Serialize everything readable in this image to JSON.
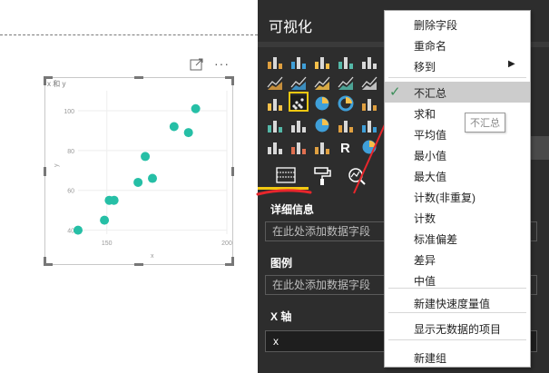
{
  "visual": {
    "title": "x 和 y",
    "focus_icon": "focus-mode-icon",
    "more_icon": "more-options-icon",
    "more_glyph": "···"
  },
  "chart_data": {
    "type": "scatter",
    "title": "x 和 y",
    "xlabel": "x",
    "ylabel": "y",
    "x_ticks": [
      "150",
      "200"
    ],
    "y_ticks": [
      "40",
      "60",
      "80",
      "100"
    ],
    "xlim": [
      138,
      200
    ],
    "ylim": [
      38,
      110
    ],
    "grid": true,
    "color": "#26bfa6",
    "points": [
      {
        "x": 138,
        "y": 40
      },
      {
        "x": 149,
        "y": 45
      },
      {
        "x": 151,
        "y": 55
      },
      {
        "x": 153,
        "y": 55
      },
      {
        "x": 163,
        "y": 64
      },
      {
        "x": 169,
        "y": 66
      },
      {
        "x": 166,
        "y": 77
      },
      {
        "x": 178,
        "y": 92
      },
      {
        "x": 184,
        "y": 89
      },
      {
        "x": 187,
        "y": 101
      }
    ]
  },
  "pane": {
    "title": "可视化",
    "tabs": [
      "fields-tab-icon",
      "format-paintroller-icon",
      "analytics-magnifier-icon"
    ],
    "wells": {
      "details_label": "详细信息",
      "details_placeholder": "在此处添加数据字段",
      "legend_label": "图例",
      "legend_placeholder": "在此处添加数据字段",
      "xaxis_label": "X 轴",
      "xaxis_value": "x"
    },
    "highlight_color": "#f2c811"
  },
  "menu": {
    "items": [
      {
        "label": "删除字段"
      },
      {
        "label": "重命名"
      },
      {
        "label": "移到"
      },
      {
        "label": "不汇总"
      },
      {
        "label": "求和"
      },
      {
        "label": "平均值"
      },
      {
        "label": "最小值"
      },
      {
        "label": "最大值"
      },
      {
        "label": "计数(非重复)"
      },
      {
        "label": "计数"
      },
      {
        "label": "标准偏差"
      },
      {
        "label": "差异"
      },
      {
        "label": "中值"
      },
      {
        "label": "新建快速度量值"
      },
      {
        "label": "显示无数据的项目"
      },
      {
        "label": "新建组"
      }
    ],
    "selected": "不汇总",
    "check_glyph": "✓",
    "submenu_arrow": "▶"
  },
  "tooltip": {
    "text": "不汇总"
  },
  "annotation_color": "#e8262b"
}
